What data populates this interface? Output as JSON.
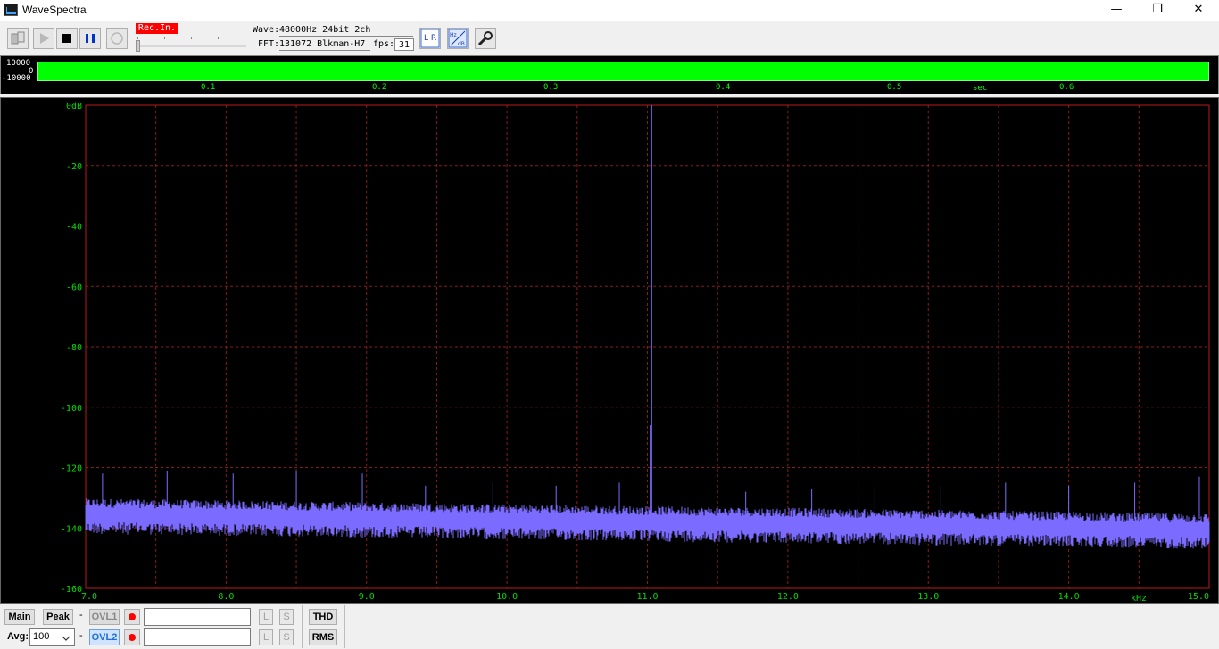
{
  "window": {
    "title": "WaveSpectra",
    "minimize": "—",
    "maximize": "❐",
    "close": "✕"
  },
  "toolbar": {
    "rec_in": "Rec.In.",
    "wave_label": "Wave:",
    "wave_value": "48000Hz 24bit 2ch",
    "fft_label": "FFT:",
    "fft_value": "131072 Blkman-H7",
    "fps_label": "fps:",
    "fps_value": "31",
    "lr_icon_text": "L R",
    "hzdb_icon_text": "Hz dB"
  },
  "wave": {
    "y_top": "10000",
    "y_mid": "0",
    "y_bottom": "-10000",
    "x_ticks": [
      "0.1",
      "0.2",
      "0.3",
      "0.4",
      "0.5",
      "0.6"
    ],
    "x_unit": "sec",
    "fill_color": "#00ff00"
  },
  "chart_data": {
    "type": "line",
    "title": "",
    "xlabel": "kHz",
    "ylabel": "",
    "xlim": [
      7.0,
      15.0
    ],
    "ylim": [
      -160,
      0
    ],
    "x_ticks": [
      "7.0",
      "8.0",
      "9.0",
      "10.0",
      "11.0",
      "12.0",
      "13.0",
      "14.0",
      "15.0"
    ],
    "y_ticks": [
      "0dB",
      "-20",
      "-40",
      "-60",
      "-80",
      "-100",
      "-120",
      "-140",
      "-160"
    ],
    "grid": true,
    "series_color": "#7b6cff",
    "grid_color": "#8b1a1a",
    "noise_floor": {
      "start_db": -135,
      "end_db": -140,
      "spread_db": 3
    },
    "peak": {
      "x": 11.03,
      "y": 0
    },
    "spurs": [
      {
        "x": 7.12,
        "y": -122
      },
      {
        "x": 7.58,
        "y": -121
      },
      {
        "x": 8.05,
        "y": -122
      },
      {
        "x": 8.5,
        "y": -121
      },
      {
        "x": 8.97,
        "y": -122
      },
      {
        "x": 9.42,
        "y": -126
      },
      {
        "x": 9.9,
        "y": -125
      },
      {
        "x": 10.35,
        "y": -126
      },
      {
        "x": 10.8,
        "y": -125
      },
      {
        "x": 11.02,
        "y": -106
      },
      {
        "x": 11.7,
        "y": -128
      },
      {
        "x": 12.17,
        "y": -127
      },
      {
        "x": 12.62,
        "y": -126
      },
      {
        "x": 13.09,
        "y": -126
      },
      {
        "x": 13.55,
        "y": -125
      },
      {
        "x": 14.0,
        "y": -126
      },
      {
        "x": 14.47,
        "y": -125
      },
      {
        "x": 14.93,
        "y": -123
      }
    ]
  },
  "bottom": {
    "main": "Main",
    "peak": "Peak",
    "dash1": "-",
    "dash2": "-",
    "ovl1": "OVL1",
    "ovl2": "OVL2",
    "l1": "L",
    "s1": "S",
    "l2": "L",
    "s2": "S",
    "thd": "THD",
    "rms": "RMS",
    "avg_label": "Avg:",
    "avg_value": "100"
  }
}
